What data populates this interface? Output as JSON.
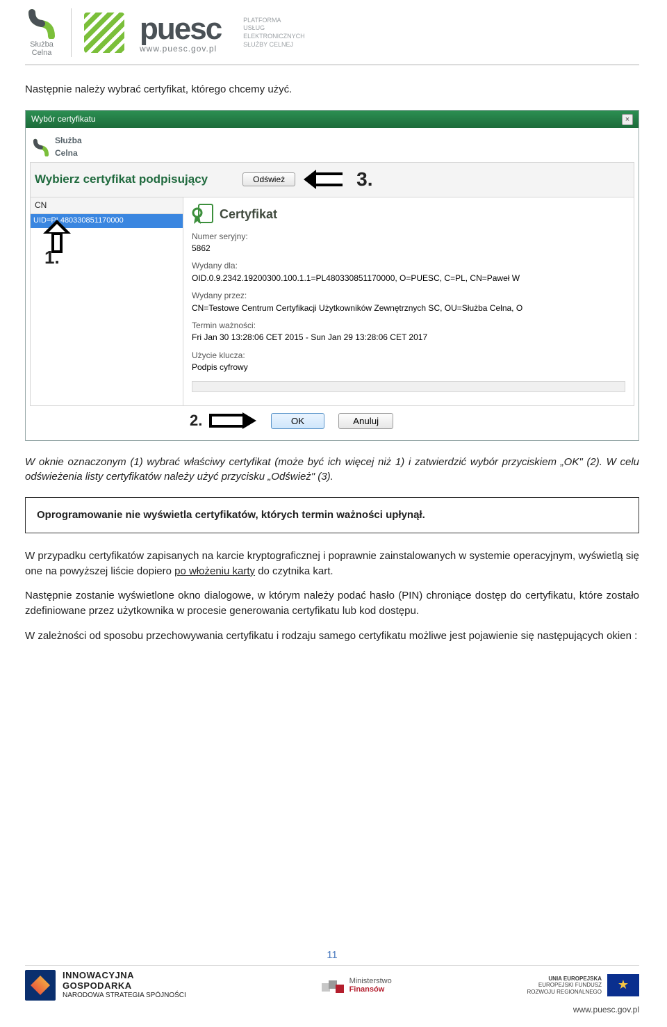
{
  "header": {
    "sc_name1": "Służba",
    "sc_name2": "Celna",
    "puesc_word": "puesc",
    "puesc_url": "www.puesc.gov.pl",
    "tag_l1": "PLATFORMA",
    "tag_l2": "USŁUG",
    "tag_l3": "ELEKTRONICZNYCH",
    "tag_l4": "SŁUŻBY CELNEJ"
  },
  "body": {
    "p1": "Następnie należy wybrać certyfikat, którego chcemy użyć.",
    "p2": "W oknie oznaczonym (1) wybrać właściwy certyfikat (może być ich więcej niż 1) i zatwierdzić wybór przyciskiem „OK\" (2). W celu odświeżenia listy certyfikatów należy użyć przycisku „Odśwież\" (3).",
    "boxnote": "Oprogramowanie nie wyświetla certyfikatów, których termin ważności upłynął.",
    "p3a": "W przypadku certyfikatów zapisanych na karcie kryptograficznej i poprawnie zainstalowanych w systemie operacyjnym, wyświetlą się one na powyższej liście dopiero ",
    "p3u": "po włożeniu karty",
    "p3b": " do czytnika kart.",
    "p4": "Następnie zostanie wyświetlone okno dialogowe, w którym należy podać hasło (PIN) chroniące dostęp do certyfikatu, które zostało zdefiniowane przez użytkownika w procesie generowania certyfikatu lub kod dostępu.",
    "p5": "W zależności od sposobu przechowywania certyfikatu i rodzaju samego certyfikatu możliwe jest pojawienie się następujących okien :"
  },
  "dialog": {
    "title": "Wybór certyfikatu",
    "logo_txt1": "Służba",
    "logo_txt2": "Celna",
    "heading": "Wybierz certyfikat podpisujący",
    "refresh": "Odśwież",
    "ann3": "3.",
    "cn": "CN",
    "uid": "UID=PL480330851170000",
    "ann1": "1.",
    "cert_title": "Certyfikat",
    "f_sn_l": "Numer seryjny:",
    "f_sn_v": "5862",
    "f_for_l": "Wydany dla:",
    "f_for_v": "OID.0.9.2342.19200300.100.1.1=PL480330851170000, O=PUESC, C=PL, CN=Paweł W",
    "f_by_l": "Wydany przez:",
    "f_by_v": "CN=Testowe Centrum Certyfikacji Użytkowników Zewnętrznych SC, OU=Służba Celna, O",
    "f_valid_l": "Termin ważności:",
    "f_valid_v": "Fri Jan 30 13:28:06 CET 2015 - Sun Jan 29 13:28:06 CET 2017",
    "f_use_l": "Użycie klucza:",
    "f_use_v": "Podpis cyfrowy",
    "ann2": "2.",
    "ok": "OK",
    "cancel": "Anuluj"
  },
  "footer": {
    "page": "11",
    "ig1": "INNOWACYJNA",
    "ig2": "GOSPODARKA",
    "ig3": "NARODOWA STRATEGIA SPÓJNOŚCI",
    "mf1": "Ministerstwo",
    "mf2": "Finansów",
    "eu1": "UNIA EUROPEJSKA",
    "eu2": "EUROPEJSKI FUNDUSZ",
    "eu3": "ROZWOJU REGIONALNEGO",
    "url": "www.puesc.gov.pl"
  }
}
